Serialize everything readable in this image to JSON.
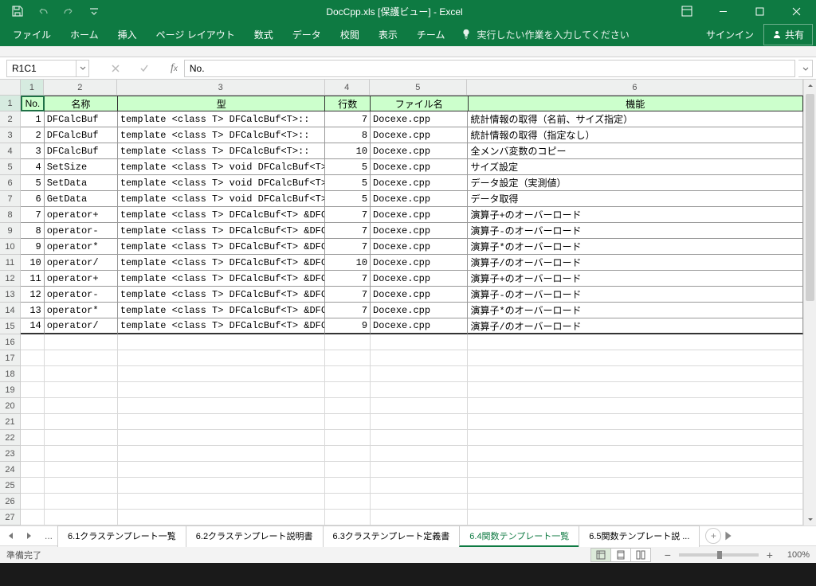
{
  "title": "DocCpp.xls  [保護ビュー] - Excel",
  "ribbon": {
    "tabs": [
      "ファイル",
      "ホーム",
      "挿入",
      "ページ レイアウト",
      "数式",
      "データ",
      "校閲",
      "表示",
      "チーム"
    ],
    "tell_me": "実行したい作業を入力してください",
    "signin": "サインイン",
    "share": "共有"
  },
  "namebox": "R1C1",
  "formula": "No.",
  "col_headers": [
    "1",
    "2",
    "3",
    "4",
    "5",
    "6"
  ],
  "row_headers": [
    "1",
    "2",
    "3",
    "4",
    "5",
    "6",
    "7",
    "8",
    "9",
    "10",
    "11",
    "12",
    "13",
    "14",
    "15",
    "16",
    "17",
    "18",
    "19",
    "20",
    "21",
    "22",
    "23",
    "24",
    "25",
    "26",
    "27"
  ],
  "table_headers": [
    "No.",
    "名称",
    "型",
    "行数",
    "ファイル名",
    "機能"
  ],
  "rows": [
    {
      "no": "1",
      "name": "DFCalcBuf",
      "type": "template <class T> DFCalcBuf<T>::",
      "lines": "7",
      "file": "Docexe.cpp",
      "func": "統計情報の取得（名前、サイズ指定）"
    },
    {
      "no": "2",
      "name": "DFCalcBuf",
      "type": "template <class T> DFCalcBuf<T>::",
      "lines": "8",
      "file": "Docexe.cpp",
      "func": "統計情報の取得（指定なし）"
    },
    {
      "no": "3",
      "name": "DFCalcBuf",
      "type": "template <class T> DFCalcBuf<T>::",
      "lines": "10",
      "file": "Docexe.cpp",
      "func": "全メンバ変数のコピー"
    },
    {
      "no": "4",
      "name": "SetSize",
      "type": "template <class T> void DFCalcBuf<T>::",
      "lines": "5",
      "file": "Docexe.cpp",
      "func": "サイズ設定"
    },
    {
      "no": "5",
      "name": "SetData",
      "type": "template <class T> void DFCalcBuf<T>::",
      "lines": "5",
      "file": "Docexe.cpp",
      "func": "データ設定（実測値）"
    },
    {
      "no": "6",
      "name": "GetData",
      "type": "template <class T> void DFCalcBuf<T>::",
      "lines": "5",
      "file": "Docexe.cpp",
      "func": "データ取得"
    },
    {
      "no": "7",
      "name": "operator+",
      "type": "template <class T> DFCalcBuf<T> &DFCal",
      "lines": "7",
      "file": "Docexe.cpp",
      "func": "演算子+のオーバーロード"
    },
    {
      "no": "8",
      "name": "operator-",
      "type": "template <class T> DFCalcBuf<T> &DFCal",
      "lines": "7",
      "file": "Docexe.cpp",
      "func": "演算子-のオーバーロード"
    },
    {
      "no": "9",
      "name": "operator*",
      "type": "template <class T> DFCalcBuf<T> &DFCal",
      "lines": "7",
      "file": "Docexe.cpp",
      "func": "演算子*のオーバーロード"
    },
    {
      "no": "10",
      "name": "operator/",
      "type": "template <class T> DFCalcBuf<T> &DFCal",
      "lines": "10",
      "file": "Docexe.cpp",
      "func": "演算子/のオーバーロード"
    },
    {
      "no": "11",
      "name": "operator+",
      "type": "template <class T> DFCalcBuf<T> &DFCal",
      "lines": "7",
      "file": "Docexe.cpp",
      "func": "演算子+のオーバーロード"
    },
    {
      "no": "12",
      "name": "operator-",
      "type": "template <class T> DFCalcBuf<T> &DFCal",
      "lines": "7",
      "file": "Docexe.cpp",
      "func": "演算子-のオーバーロード"
    },
    {
      "no": "13",
      "name": "operator*",
      "type": "template <class T> DFCalcBuf<T> &DFCal",
      "lines": "7",
      "file": "Docexe.cpp",
      "func": "演算子*のオーバーロード"
    },
    {
      "no": "14",
      "name": "operator/",
      "type": "template <class T> DFCalcBuf<T> &DFCal",
      "lines": "9",
      "file": "Docexe.cpp",
      "func": "演算子/のオーバーロード"
    }
  ],
  "tabs": {
    "ellipsis": "...",
    "list": [
      "6.1クラステンプレート一覧",
      "6.2クラステンプレート説明書",
      "6.3クラステンプレート定義書",
      "6.4関数テンプレート一覧",
      "6.5関数テンプレート説 ..."
    ],
    "active_index": 3
  },
  "status": {
    "label": "準備完了",
    "zoom": "100%"
  }
}
